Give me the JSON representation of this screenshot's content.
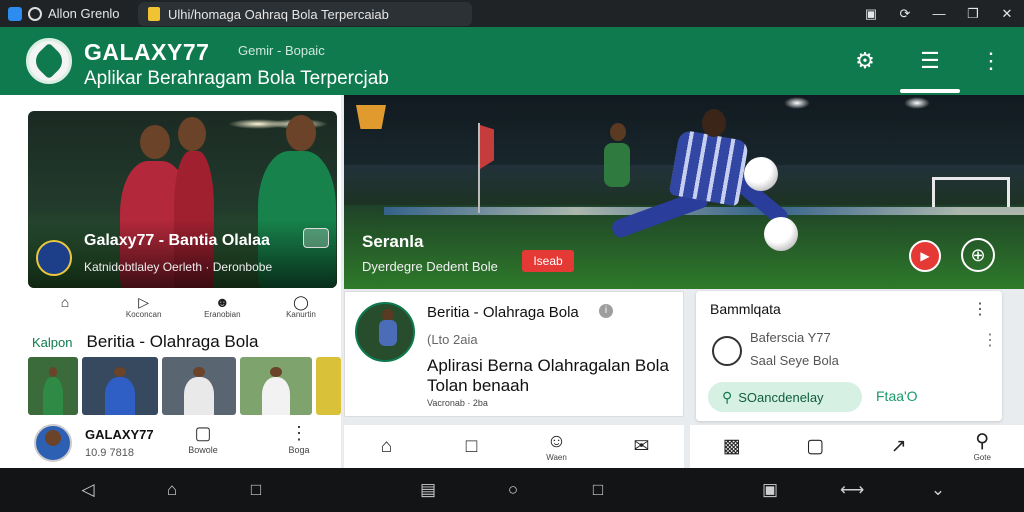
{
  "status_bar": {
    "app_label": "Allon Grenlo",
    "tab_title": "Ulhi/homaga Oahraq Bola Terpercaiab",
    "icons": [
      "save-icon",
      "sync-icon",
      "minimize-icon",
      "restore-icon",
      "close-icon"
    ]
  },
  "header": {
    "brand": "GALAXY77",
    "brand_sub": "Gemir - Bopaic",
    "tagline": "Aplikar Berahragam Bola Terpercjab",
    "colors": {
      "primary": "#0f7a4e",
      "accent": "#e53935"
    }
  },
  "hero_left": {
    "title": "Galaxy77 - Bantia Olalaa",
    "subtitle": "Katnidobtlaley Oerleth · Deronbobe"
  },
  "categories": [
    {
      "icon": "home-icon",
      "label": ""
    },
    {
      "icon": "video-icon",
      "label": "Koconcan"
    },
    {
      "icon": "team-icon",
      "label": "Eranobian"
    },
    {
      "icon": "chat-icon",
      "label": "Kanurtin"
    }
  ],
  "news": {
    "kicker": "Kalpon",
    "title": "Beritia - Olahraga Bola"
  },
  "left_footer": {
    "name": "GALAXY77",
    "time": "10.9 7818",
    "action1_label": "Bowole",
    "action2_label": "Boga"
  },
  "hero_right": {
    "title": "Seranla",
    "subtitle": "Dyerdegre  Dedent Bole",
    "badge": "Iseab"
  },
  "article": {
    "title": "Beritia - Olahraga Bola",
    "meta": "(Lto 2aia",
    "headline": "Aplirasi Berna Olahragalan Bola Tolan benaah",
    "footer": "Vacronab · 2ba"
  },
  "right_card": {
    "title": "Bammlqata",
    "name": "Baferscia Y77",
    "sub": "Saal Seye Bola",
    "button": "SOancdenelay",
    "link": "Ftaa'O"
  },
  "mid_nav": [
    {
      "icon": "home-icon",
      "label": ""
    },
    {
      "icon": "edit-icon",
      "label": ""
    },
    {
      "icon": "smiley-icon",
      "label": "Waen"
    },
    {
      "icon": "mail-icon",
      "label": ""
    }
  ],
  "right_nav": [
    {
      "icon": "bag-icon",
      "label": ""
    },
    {
      "icon": "tv-icon",
      "label": ""
    },
    {
      "icon": "arrow-icon",
      "label": ""
    },
    {
      "icon": "profile-icon",
      "label": "Gote"
    }
  ]
}
